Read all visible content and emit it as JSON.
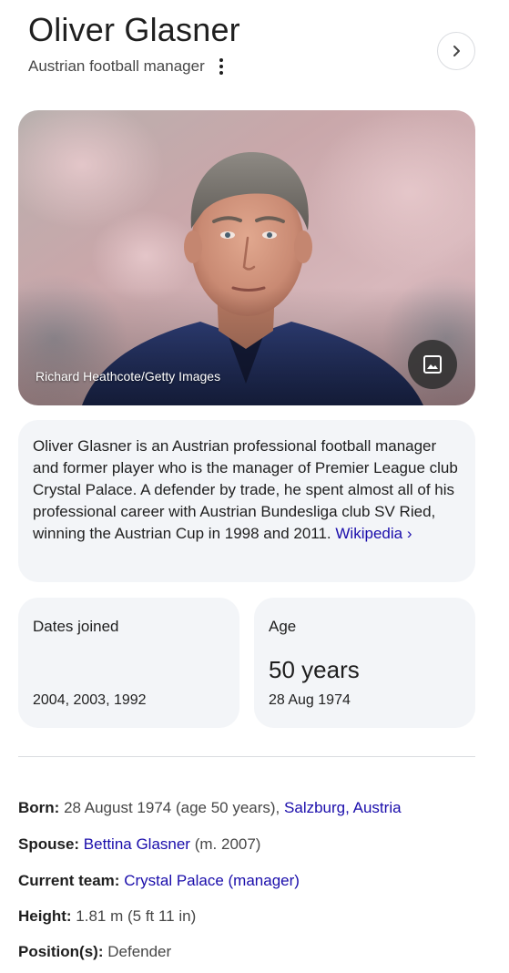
{
  "header": {
    "title": "Oliver Glasner",
    "subtitle": "Austrian football manager"
  },
  "icons": {
    "more": "more-vert-icon",
    "next": "chevron-right-icon",
    "image": "image-icon"
  },
  "photo": {
    "credit": "Richard Heathcote/Getty Images"
  },
  "description": {
    "text": "Oliver Glasner is an Austrian professional football manager and former player who is the manager of Premier League club Crystal Palace. A defender by trade, he spent almost all of his professional career with Austrian Bundesliga club SV Ried, winning the Austrian Cup in 1998 and 2011.",
    "source_link": "Wikipedia",
    "source_arrow": "›"
  },
  "cards": {
    "dates_joined": {
      "label": "Dates joined",
      "value": "2004, 2003, 1992"
    },
    "age": {
      "label": "Age",
      "value": "50 years",
      "detail": "28 Aug 1974"
    }
  },
  "facts": {
    "born": {
      "label": "Born:",
      "text": "28 August 1974 (age 50 years),",
      "link": "Salzburg, Austria"
    },
    "spouse": {
      "label": "Spouse:",
      "link": "Bettina Glasner",
      "text": "(m. 2007)"
    },
    "current_team": {
      "label": "Current team:",
      "link": "Crystal Palace (manager)"
    },
    "height": {
      "label": "Height:",
      "text": "1.81 m (5 ft 11 in)"
    },
    "position": {
      "label": "Position(s):",
      "text": "Defender"
    }
  },
  "colors": {
    "link": "#1a0dab",
    "card_background": "#f3f5f8",
    "text": "#1f1f1f",
    "secondary_text": "#474747"
  }
}
